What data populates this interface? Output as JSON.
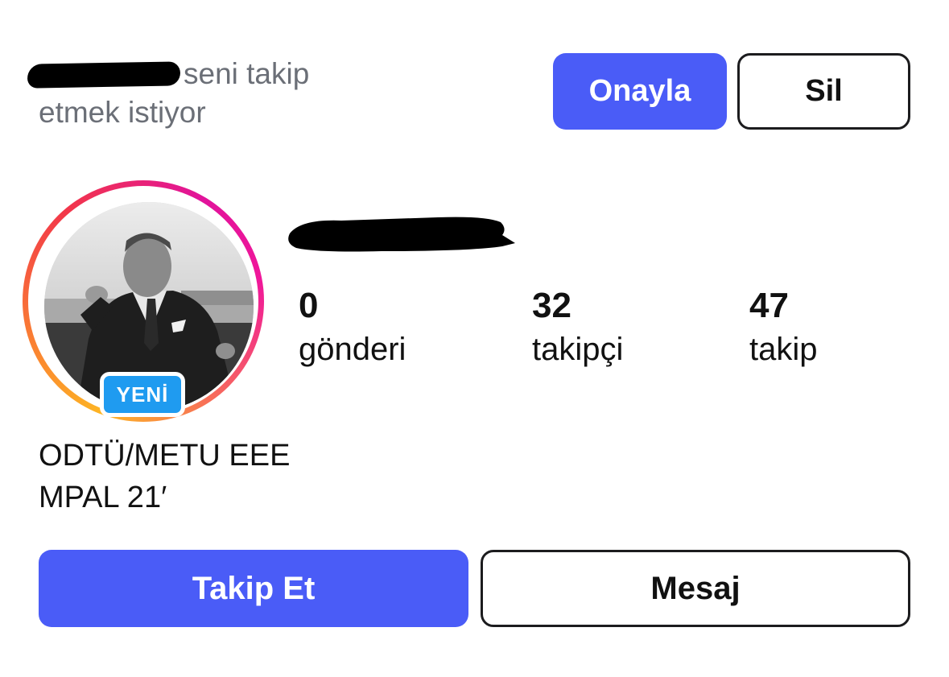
{
  "follow_request": {
    "text_line1": "seni takip",
    "text_line2": "etmek istiyor",
    "approve_label": "Onayla",
    "delete_label": "Sil"
  },
  "profile": {
    "badge": "YENİ",
    "stats": [
      {
        "count": "0",
        "label": "gönderi"
      },
      {
        "count": "32",
        "label": "takipçi"
      },
      {
        "count": "47",
        "label": "takip"
      }
    ],
    "bio_line1": "ODTÜ/METU EEE",
    "bio_line2": "MPAL 21′"
  },
  "actions": {
    "follow_label": "Takip Et",
    "message_label": "Mesaj"
  },
  "colors": {
    "accent": "#4a5cf7",
    "badge": "#1f9bf0",
    "text_muted": "#6b6f77"
  }
}
